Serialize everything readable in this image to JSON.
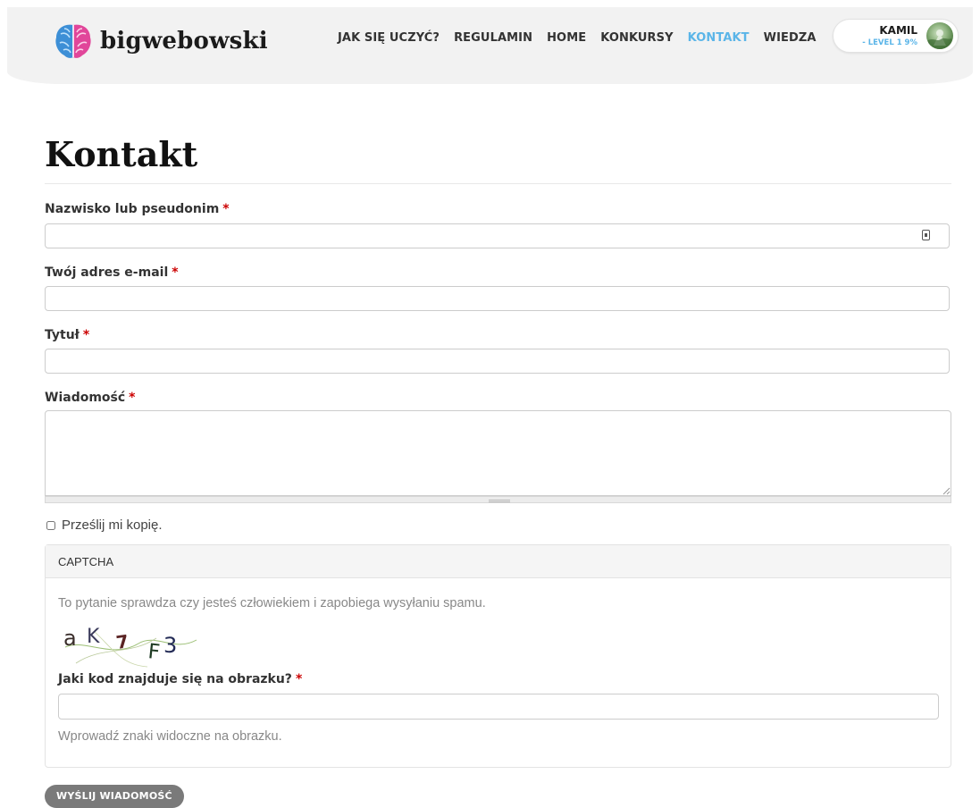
{
  "header": {
    "logo_text": "bigwebowski",
    "nav": [
      {
        "label": "JAK SIĘ UCZYĆ?",
        "active": false
      },
      {
        "label": "REGULAMIN",
        "active": false
      },
      {
        "label": "HOME",
        "active": false
      },
      {
        "label": "KONKURSY",
        "active": false
      },
      {
        "label": "KONTAKT",
        "active": true
      },
      {
        "label": "WIEDZA",
        "active": false
      }
    ],
    "user": {
      "name": "KAMIL",
      "level": "- LEVEL 1 9%"
    }
  },
  "page": {
    "title": "Kontakt"
  },
  "form": {
    "required_mark": "*",
    "name_label": "Nazwisko lub pseudonim",
    "email_label": "Twój adres e-mail",
    "subject_label": "Tytuł",
    "message_label": "Wiadomość",
    "copy_label": "Prześlij mi kopię.",
    "name_value": "",
    "email_value": "",
    "subject_value": "",
    "message_value": ""
  },
  "captcha": {
    "title": "CAPTCHA",
    "description": "To pytanie sprawdza czy jesteś człowiekiem i zapobiega wysyłaniu spamu.",
    "image_text": "aK7F3",
    "question": "Jaki kod znajduje się na obrazku?",
    "answer_value": "",
    "help": "Wprowadź znaki widoczne na obrazku."
  },
  "submit_label": "WYŚLIJ WIADOMOŚĆ",
  "colors": {
    "accent": "#5bb5e8",
    "required": "#cc0000",
    "button": "#7a7a7a"
  }
}
